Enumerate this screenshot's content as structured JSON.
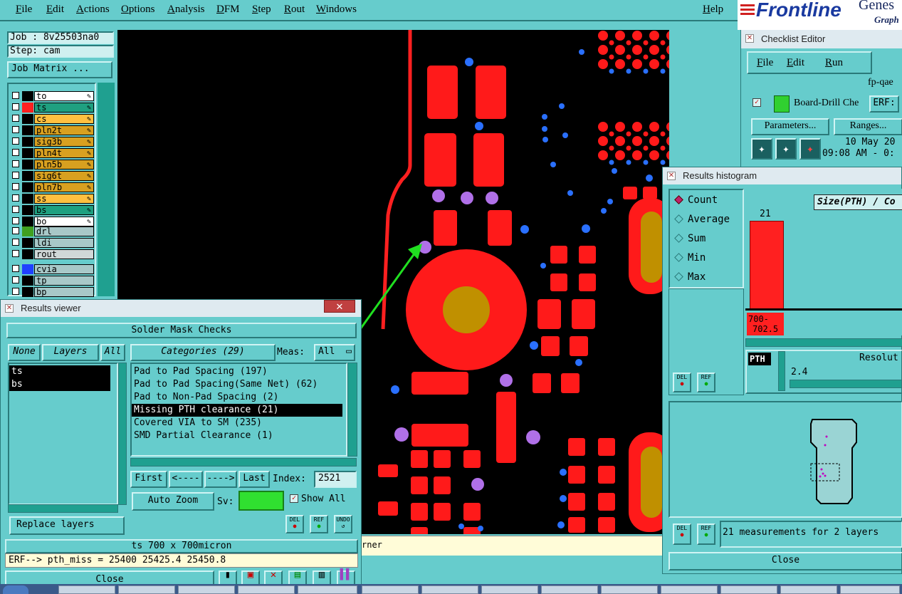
{
  "menubar": {
    "items": [
      "File",
      "Edit",
      "Actions",
      "Options",
      "Analysis",
      "DFM",
      "Step",
      "Rout",
      "Windows"
    ],
    "help": "Help"
  },
  "logo": {
    "brand": "Frontline",
    "partial1": "Genes",
    "partial2": "Graph"
  },
  "job": {
    "job": "Job : 8v25503na0",
    "step": "Step: cam",
    "matrix_button": "Job Matrix ..."
  },
  "layers": [
    {
      "name": "to",
      "color": "#ffffff",
      "swatch": "#000000"
    },
    {
      "name": "ts",
      "color": "#1fa080",
      "swatch": "#ff2020"
    },
    {
      "name": "cs",
      "color": "#ffc040",
      "swatch": "#000000"
    },
    {
      "name": "pln2t",
      "color": "#d8a020",
      "swatch": "#000000"
    },
    {
      "name": "sig3b",
      "color": "#d8a020",
      "swatch": "#000000"
    },
    {
      "name": "pln4t",
      "color": "#d8a020",
      "swatch": "#000000"
    },
    {
      "name": "pln5b",
      "color": "#d8a020",
      "swatch": "#000000"
    },
    {
      "name": "sig6t",
      "color": "#d8a020",
      "swatch": "#000000"
    },
    {
      "name": "pln7b",
      "color": "#d8a020",
      "swatch": "#000000"
    },
    {
      "name": "ss",
      "color": "#ffc040",
      "swatch": "#000000"
    },
    {
      "name": "bs",
      "color": "#1fa080",
      "swatch": "#000000"
    },
    {
      "name": "bo",
      "color": "#ffffff",
      "swatch": "#000000"
    }
  ],
  "drill_layers": [
    {
      "name": "drl",
      "color": "#a8c8c8",
      "swatch": "#40a020"
    },
    {
      "name": "ldi",
      "color": "#a8c8c8",
      "swatch": "#000000"
    },
    {
      "name": "rout",
      "color": "#d0d8d8",
      "swatch": "#000000"
    }
  ],
  "other_layers": [
    {
      "name": "cvia",
      "color": "#a8c8c8",
      "swatch": "#2040ff"
    },
    {
      "name": "tp",
      "color": "#a8c8c8",
      "swatch": "#000000"
    },
    {
      "name": "bp",
      "color": "#a8c8c8",
      "swatch": "#000000"
    }
  ],
  "results_viewer": {
    "title": "Results viewer",
    "header": "Solder Mask Checks",
    "none": "None",
    "layers": "Layers",
    "all": "All",
    "categories": "Categories (29)",
    "meas_label": "Meas:",
    "meas_value": "All",
    "layer_list": [
      "ts",
      "bs"
    ],
    "category_items": [
      "Pad to Pad Spacing (197)",
      "Pad to Pad Spacing(Same Net) (62)",
      "Pad to Non-Pad Spacing (2)",
      "Missing PTH clearance (21)",
      "Covered VIA to SM (235)",
      "SMD Partial Clearance (1)"
    ],
    "selected_index": 3,
    "first": "First",
    "prev": "<----",
    "next": "---->",
    "last": "Last",
    "index_label": "Index:",
    "index_value": "2521",
    "auto_zoom": "Auto Zoom",
    "sv": "Sv:",
    "show_all": "Show All",
    "replace_layers": "Replace layers",
    "del": "DEL",
    "ref": "REF",
    "undo": "UNDO",
    "status": "ts 700 x 700micron",
    "erf": "ERF--> pth_miss = 25400 25425.4 25450.8",
    "close": "Close",
    "corner": "rner"
  },
  "checklist": {
    "title": "Checklist Editor",
    "menu": [
      "File",
      "Edit",
      "Run"
    ],
    "name": "fp-qae",
    "check_label": "Board-Drill Che",
    "erf": "ERF:",
    "parameters": "Parameters...",
    "ranges": "Ranges...",
    "date": "10 May 20",
    "time": "09:08 AM - 0:"
  },
  "histogram": {
    "title": "Results histogram",
    "modes": [
      "Count",
      "Average",
      "Sum",
      "Min",
      "Max"
    ],
    "selected_mode": "Count",
    "chart_title": "Size(PTH) / Co",
    "bar_value": "21",
    "bar_label_1": "700-",
    "bar_label_2": "702.5",
    "pth": "PTH",
    "resolution": "Resolut",
    "res_value": "2.4",
    "summary": "21 measurements for 2 layers",
    "close": "Close",
    "del": "DEL",
    "ref": "REF"
  }
}
